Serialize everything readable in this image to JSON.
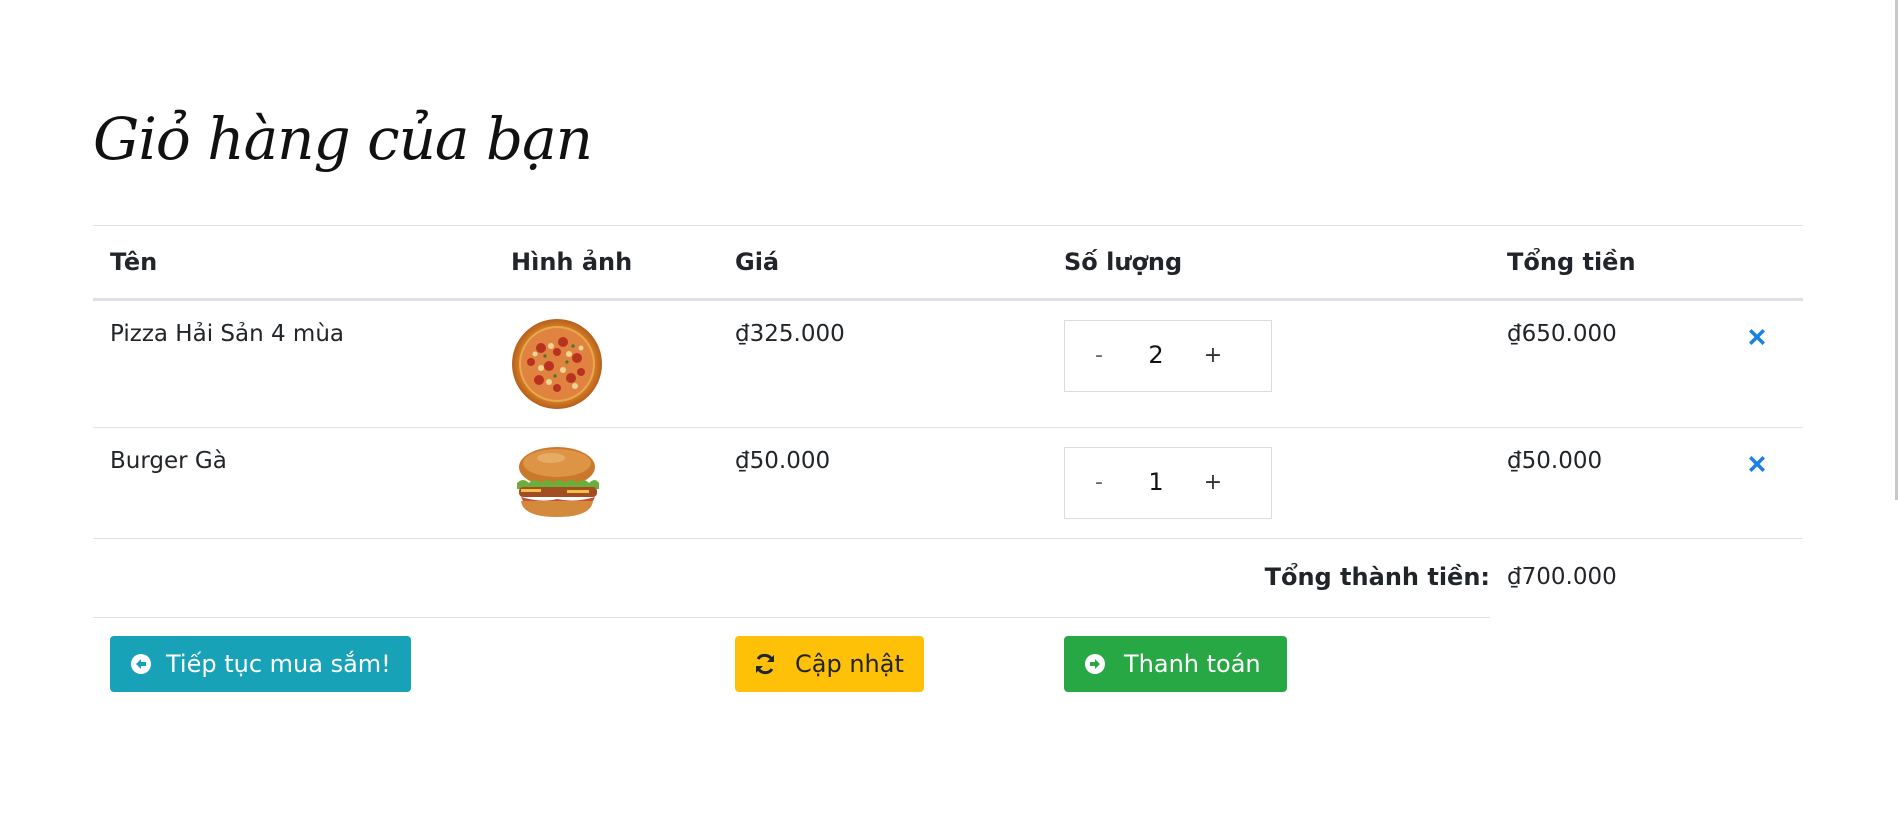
{
  "page": {
    "title": "Giỏ hàng của bạn"
  },
  "table": {
    "headers": {
      "name": "Tên",
      "image": "Hình ảnh",
      "price": "Giá",
      "quantity": "Số lượng",
      "total": "Tổng tiền"
    },
    "rows": [
      {
        "name": "Pizza Hải Sản 4 mùa",
        "image": "pizza-image",
        "price": "₫325.000",
        "quantity": "2",
        "total": "₫650.000"
      },
      {
        "name": "Burger Gà",
        "image": "burger-image",
        "price": "₫50.000",
        "quantity": "1",
        "total": "₫50.000"
      }
    ],
    "qty_minus": "-",
    "qty_plus": "+"
  },
  "summary": {
    "label": "Tổng thành tiền:",
    "value": "₫700.000"
  },
  "actions": {
    "continue_label": "Tiếp tục mua sắm!",
    "update_label": "Cập nhật",
    "checkout_label": "Thanh toán"
  },
  "colors": {
    "continue": "#17a2b8",
    "update": "#ffc107",
    "checkout": "#28a745",
    "remove_icon": "#1a7fe8"
  },
  "icons": {
    "remove": "times-icon",
    "continue": "arrow-circle-left-icon",
    "update": "refresh-icon",
    "checkout": "arrow-circle-right-icon"
  }
}
